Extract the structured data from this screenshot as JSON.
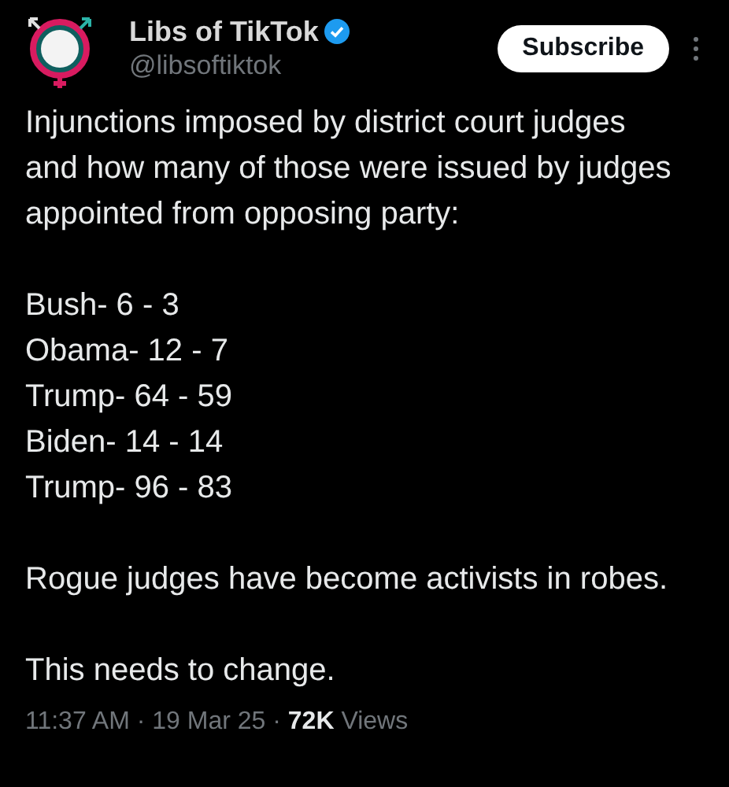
{
  "author": {
    "name": "Libs of TikTok",
    "verified": true,
    "handle": "@libsoftiktok"
  },
  "subscribe_button": "Subscribe",
  "body": [
    {
      "kind": "paragraph",
      "text": "Injunctions imposed by district court judges and how many of those were issued by judges appointed from opposing party:"
    },
    {
      "kind": "list",
      "lines": [
        "Bush- 6 - 3",
        "Obama- 12 - 7",
        "Trump- 64 - 59",
        "Biden- 14 - 14",
        "Trump- 96 - 83"
      ]
    },
    {
      "kind": "paragraph",
      "text": "Rogue judges have become activists in robes."
    },
    {
      "kind": "paragraph",
      "text": "This needs to change."
    }
  ],
  "meta": "11:37 AM · 19 Mar 25 · **72K** Views"
}
